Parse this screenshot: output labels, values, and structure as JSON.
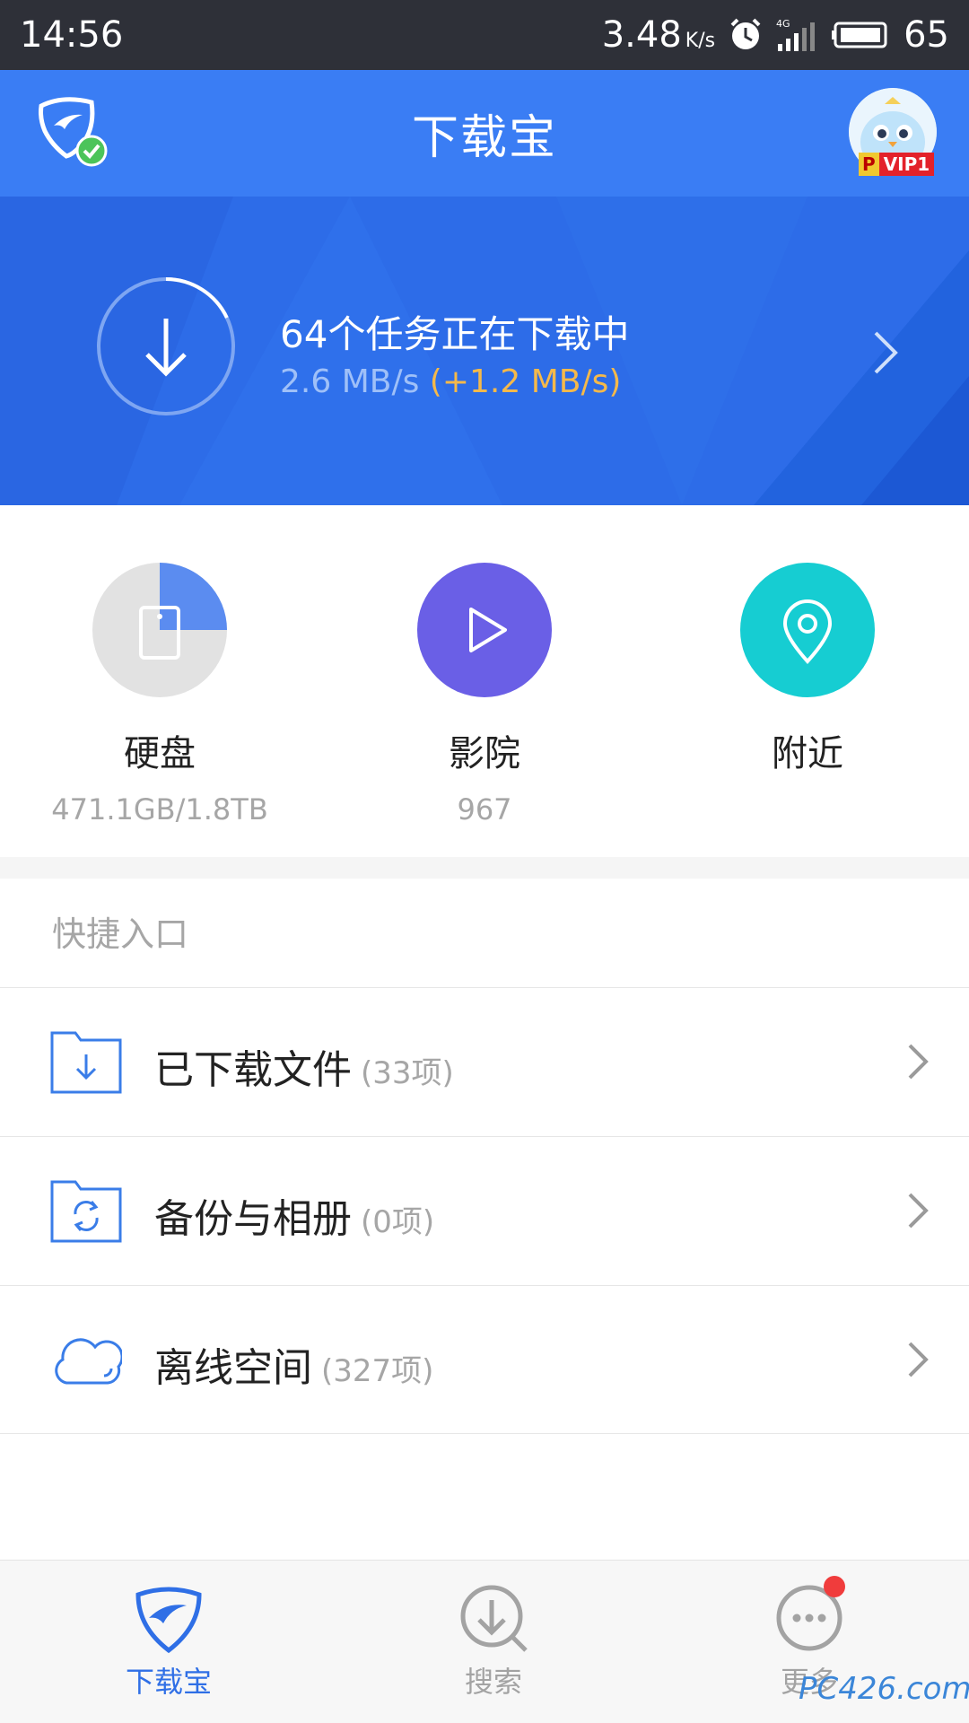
{
  "status_bar": {
    "time": "14:56",
    "net_speed": "3.48",
    "net_unit": "K/s",
    "network_type": "4G",
    "battery": "65",
    "icons": [
      "alarm-icon",
      "signal-icon",
      "battery-icon"
    ]
  },
  "header": {
    "title": "下载宝",
    "vip_p": "P",
    "vip_level": "VIP1"
  },
  "banner": {
    "task_text": "64个任务正在下载中",
    "speed": "2.6 MB/s",
    "speed_extra": "(+1.2 MB/s)",
    "progress": 0.18
  },
  "features": [
    {
      "label": "硬盘",
      "sub": "471.1GB/1.8TB",
      "icon": "hard-disk-icon",
      "color": "#5b8cf0",
      "used_fraction": 0.25
    },
    {
      "label": "影院",
      "sub": "967",
      "icon": "play-icon",
      "color": "#6a5fe6"
    },
    {
      "label": "附近",
      "sub": "",
      "icon": "location-pin-icon",
      "color": "#16cdd2"
    }
  ],
  "quick_title": "快捷入口",
  "quick_items": [
    {
      "label": "已下载文件",
      "count": "(33项)",
      "icon": "download-folder-icon"
    },
    {
      "label": "备份与相册",
      "count": "(0项)",
      "icon": "backup-folder-icon"
    },
    {
      "label": "离线空间",
      "count": "(327项)",
      "icon": "cloud-icon"
    }
  ],
  "bottom_nav": [
    {
      "label": "下载宝",
      "icon": "shield-logo-icon",
      "active": true
    },
    {
      "label": "搜索",
      "icon": "search-download-icon",
      "active": false
    },
    {
      "label": "更多",
      "icon": "more-icon",
      "active": false
    }
  ],
  "watermark": "PC426.com",
  "colors": {
    "header": "#3a7df4",
    "banner": "#2d6ce8",
    "accent_orange": "#f5b94a",
    "accent_blue": "#2f6fe6"
  }
}
